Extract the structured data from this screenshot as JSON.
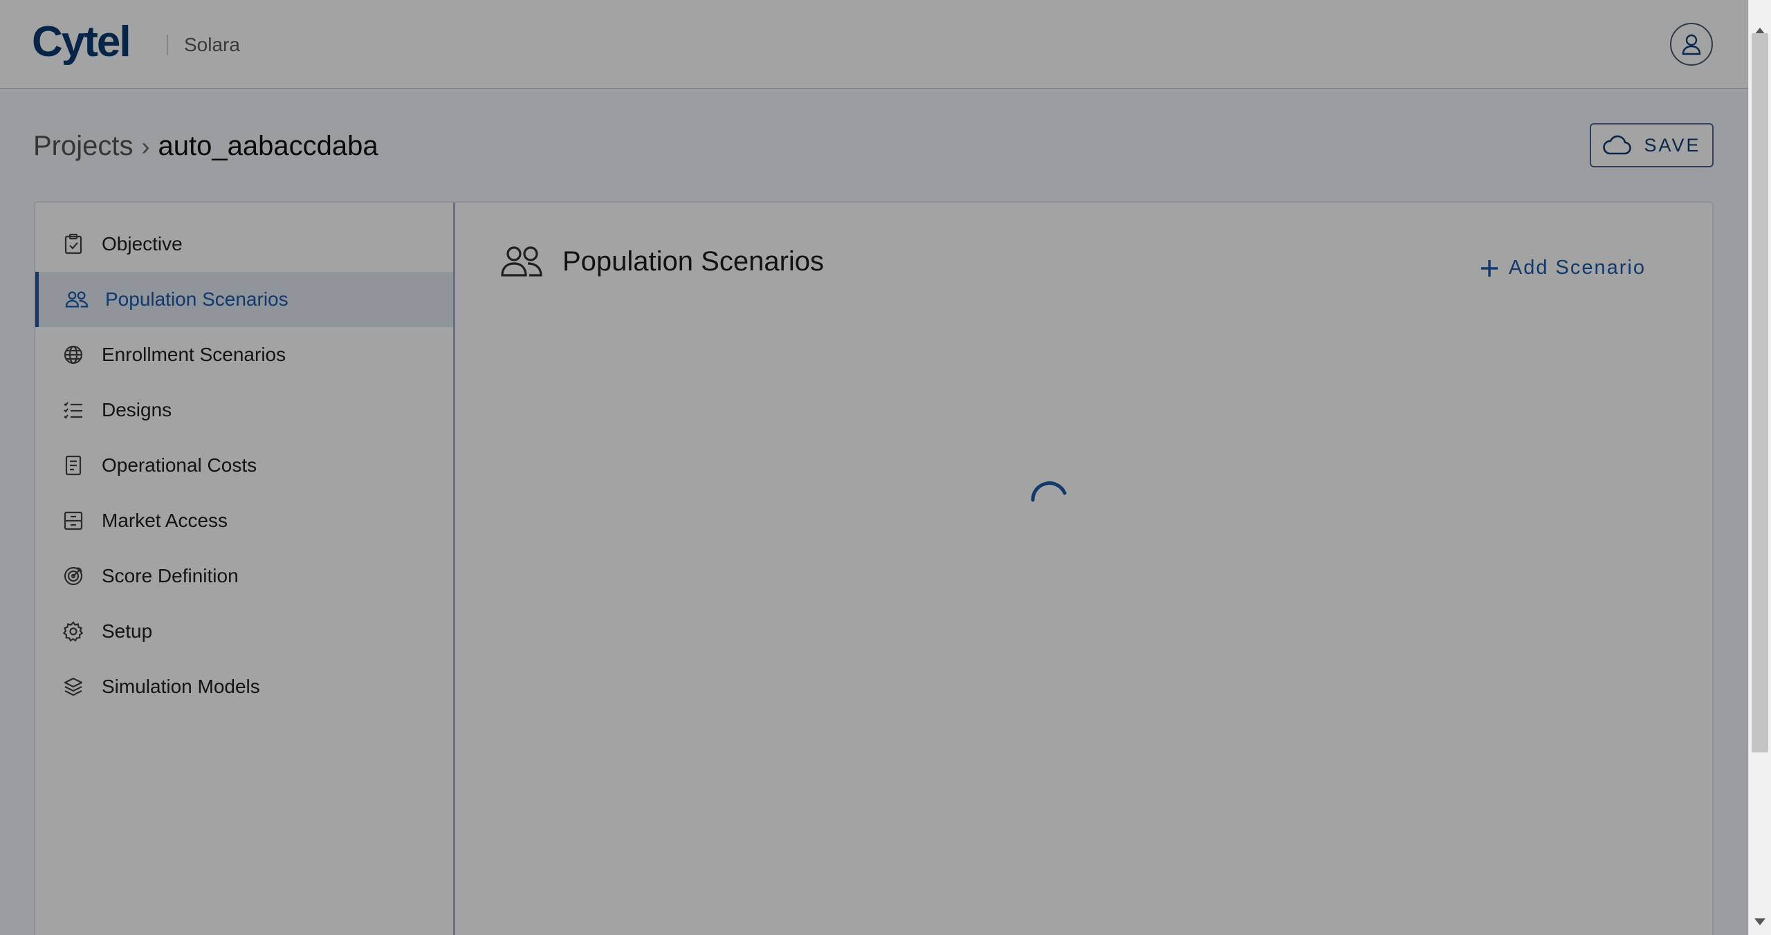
{
  "header": {
    "logo": "Cytel",
    "app_name": "Solara",
    "avatar_icon": "user-icon"
  },
  "breadcrumb": {
    "root": "Projects",
    "separator": "›",
    "current": "auto_aabaccdaba"
  },
  "toolbar": {
    "save_label": "SAVE",
    "save_icon": "cloud-icon"
  },
  "sidebar": {
    "items": [
      {
        "label": "Objective",
        "icon": "clipboard-check-icon",
        "active": false
      },
      {
        "label": "Population Scenarios",
        "icon": "users-icon",
        "active": true
      },
      {
        "label": "Enrollment Scenarios",
        "icon": "globe-icon",
        "active": false
      },
      {
        "label": "Designs",
        "icon": "checklist-icon",
        "active": false
      },
      {
        "label": "Operational Costs",
        "icon": "receipt-icon",
        "active": false
      },
      {
        "label": "Market Access",
        "icon": "archive-icon",
        "active": false
      },
      {
        "label": "Score Definition",
        "icon": "target-icon",
        "active": false
      },
      {
        "label": "Setup",
        "icon": "gear-icon",
        "active": false
      },
      {
        "label": "Simulation Models",
        "icon": "layers-icon",
        "active": false
      }
    ]
  },
  "main": {
    "title": "Population Scenarios",
    "title_icon": "users-icon",
    "add_label": "Add Scenario",
    "add_icon": "plus-icon",
    "loading": true
  },
  "colors": {
    "brand": "#0a3a73",
    "accent": "#1b5aa8",
    "overlay": "rgba(0,0,0,0.36)"
  }
}
